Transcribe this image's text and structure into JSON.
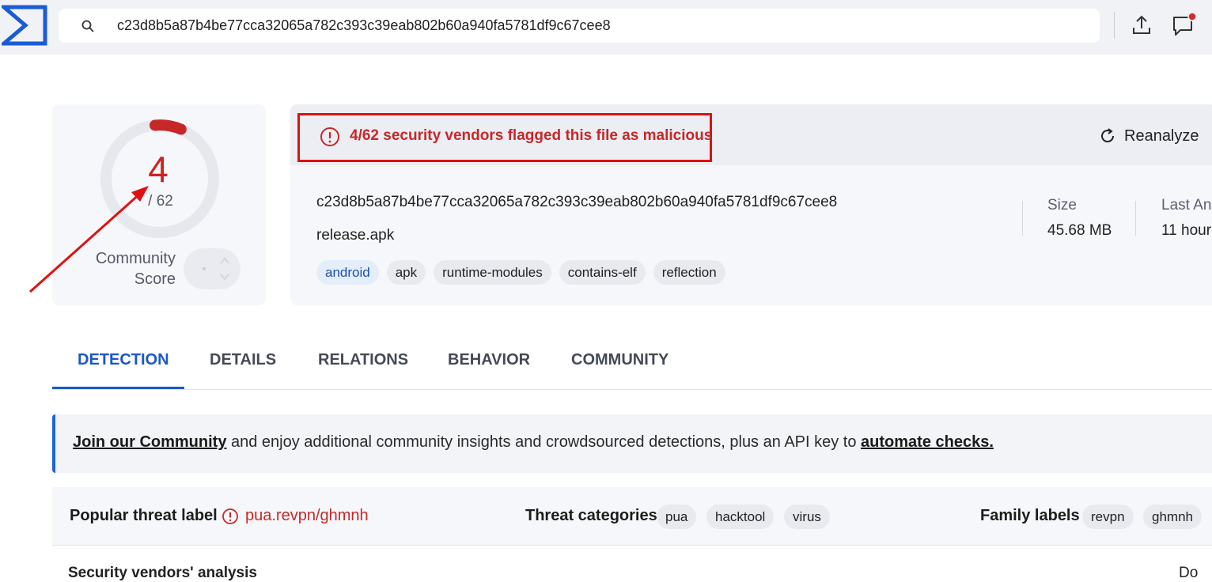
{
  "search": {
    "value": "c23d8b5a87b4be77cca32065a782c393c39eab802b60a940fa5781df9c67cee8"
  },
  "score": {
    "detections": "4",
    "total": "/ 62",
    "detection_ratio": 0.0645,
    "community_label_line1": "Community",
    "community_label_line2": "Score"
  },
  "summary": {
    "alert": "4/62 security vendors flagged this file as malicious",
    "reanalyze_label": "Reanalyze",
    "hash": "c23d8b5a87b4be77cca32065a782c393c39eab802b60a940fa5781df9c67cee8",
    "file_name": "release.apk",
    "tags": [
      "android",
      "apk",
      "runtime-modules",
      "contains-elf",
      "reflection"
    ],
    "size_label": "Size",
    "size_value": "45.68 MB",
    "last_label": "Last An",
    "last_value": "11 hour"
  },
  "tabs": [
    "DETECTION",
    "DETAILS",
    "RELATIONS",
    "BEHAVIOR",
    "COMMUNITY"
  ],
  "banner": {
    "join_link": "Join our Community",
    "middle": " and enjoy additional community insights and crowdsourced detections, plus an API key to ",
    "automate_link": "automate checks."
  },
  "threat": {
    "popular_label": "Popular threat label",
    "popular_value": "pua.revpn/ghmnh",
    "categories_label": "Threat categories",
    "categories": [
      "pua",
      "hacktool",
      "virus"
    ],
    "family_label": "Family labels",
    "families": [
      "revpn",
      "ghmnh"
    ]
  },
  "bottom": {
    "left": "Security vendors' analysis",
    "right": "Do"
  },
  "colors": {
    "malicious_red": "#c62828",
    "accent_blue": "#1c57c9",
    "annotation_red": "#e01010"
  },
  "icons": {
    "logo": "virustotal-logo",
    "search": "search-icon",
    "upload": "upload-icon",
    "feedback": "feedback-chat-icon",
    "alert": "exclamation-circle-icon",
    "reanalyze": "refresh-icon"
  }
}
